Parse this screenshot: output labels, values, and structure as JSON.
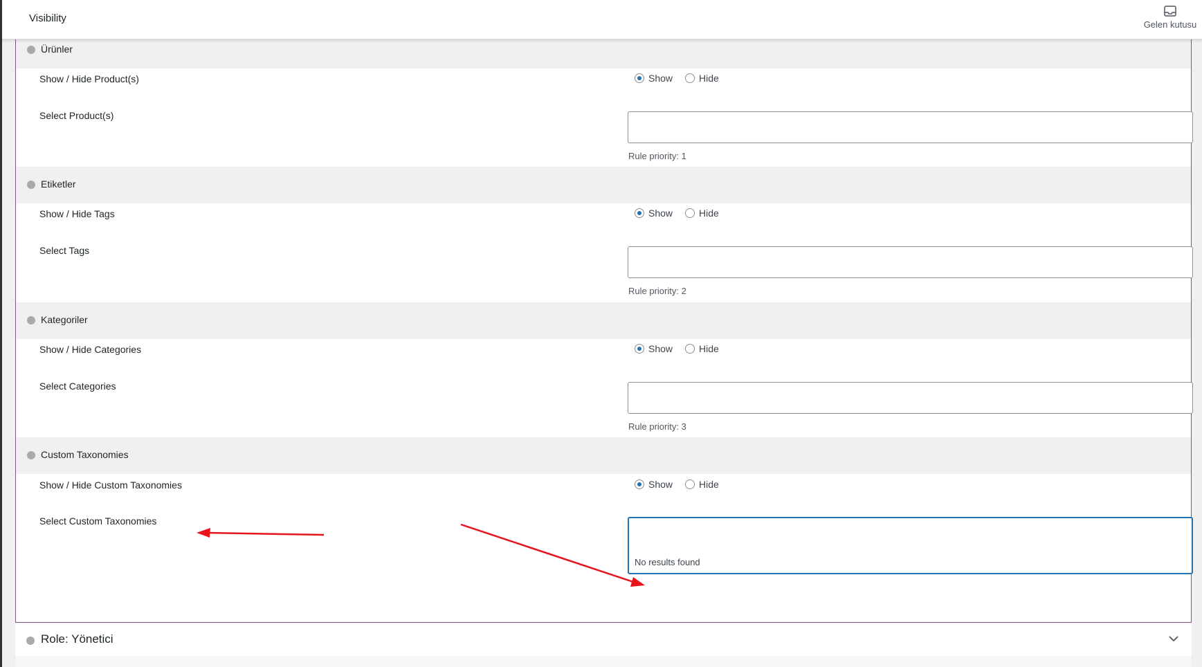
{
  "topbar": {
    "title": "Visibility",
    "inbox_label": "Gelen kutusu",
    "inbox_icon": "inbox-icon"
  },
  "radio_labels": {
    "show": "Show",
    "hide": "Hide"
  },
  "sections": [
    {
      "name": "Ürünler",
      "toggle_label": "Show / Hide Product(s)",
      "select_label": "Select Product(s)",
      "priority": "Rule priority: 1",
      "selected": "show"
    },
    {
      "name": "Etiketler",
      "toggle_label": "Show / Hide Tags",
      "select_label": "Select Tags",
      "priority": "Rule priority: 2",
      "selected": "show"
    },
    {
      "name": "Kategoriler",
      "toggle_label": "Show / Hide Categories",
      "select_label": "Select Categories",
      "priority": "Rule priority: 3",
      "selected": "show"
    },
    {
      "name": "Custom Taxonomies",
      "toggle_label": "Show / Hide Custom Taxonomies",
      "select_label": "Select Custom Taxonomies",
      "dropdown_message": "No results found",
      "selected": "show"
    }
  ],
  "role": {
    "name": "Role: Yönetici"
  },
  "colors": {
    "accent": "#2271b1",
    "panel_border": "#7f5382",
    "annotation": "#e8141a"
  }
}
